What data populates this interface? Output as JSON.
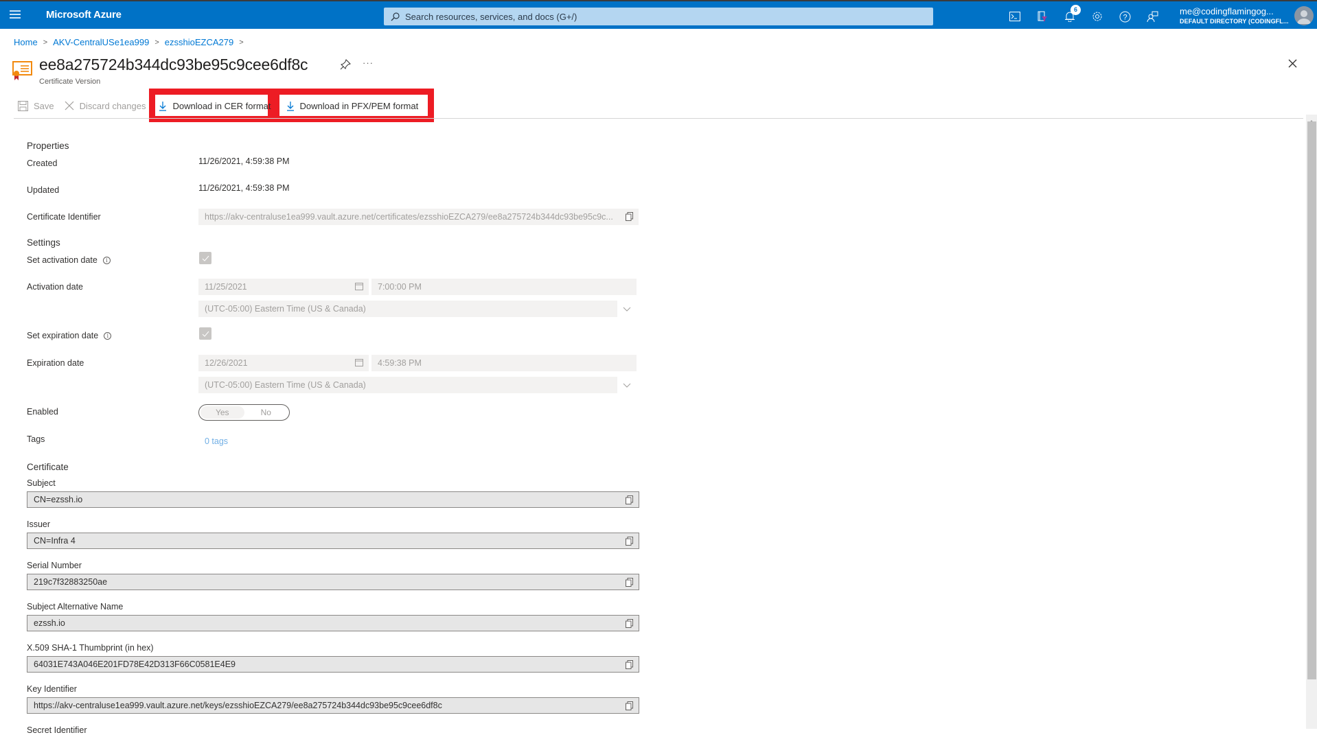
{
  "topbar": {
    "brand": "Microsoft Azure",
    "search_placeholder": "Search resources, services, and docs (G+/)",
    "notification_count": "6",
    "icons": [
      "cloud-shell-icon",
      "directory-filter-icon",
      "notifications-icon",
      "settings-icon",
      "help-icon",
      "feedback-icon"
    ],
    "account_email": "me@codingflamingog...",
    "account_directory": "DEFAULT DIRECTORY (CODINGFL..."
  },
  "breadcrumb": [
    "Home",
    "AKV-CentralUSe1ea999",
    "ezsshioEZCA279"
  ],
  "header": {
    "title": "ee8a275724b344dc93be95c9cee6df8c",
    "subtitle": "Certificate Version",
    "more_label": "···"
  },
  "toolbar": {
    "save": "Save",
    "discard": "Discard changes",
    "download_cer": "Download in CER format",
    "download_pfx": "Download in PFX/PEM format",
    "highlight_color": "#ed1c24"
  },
  "properties": {
    "section": "Properties",
    "created_label": "Created",
    "created_value": "11/26/2021, 4:59:38 PM",
    "updated_label": "Updated",
    "updated_value": "11/26/2021, 4:59:38 PM",
    "identifier_label": "Certificate Identifier",
    "identifier_value": "https://akv-centraluse1ea999.vault.azure.net/certificates/ezsshioEZCA279/ee8a275724b344dc93be95c9c..."
  },
  "settings": {
    "section": "Settings",
    "set_activation_label": "Set activation date",
    "set_activation_checked": true,
    "activation_label": "Activation date",
    "activation_date": "11/25/2021",
    "activation_time": "7:00:00 PM",
    "activation_tz": "(UTC-05:00) Eastern Time (US & Canada)",
    "set_expiration_label": "Set expiration date",
    "set_expiration_checked": true,
    "expiration_label": "Expiration date",
    "expiration_date": "12/26/2021",
    "expiration_time": "4:59:38 PM",
    "expiration_tz": "(UTC-05:00) Eastern Time (US & Canada)",
    "enabled_label": "Enabled",
    "enabled_yes": "Yes",
    "enabled_no": "No",
    "enabled_selected": "Yes",
    "tags_label": "Tags",
    "tags_value": "0 tags"
  },
  "certificate": {
    "section": "Certificate",
    "fields": [
      {
        "label": "Subject",
        "value": "CN=ezssh.io"
      },
      {
        "label": "Issuer",
        "value": "CN=Infra 4"
      },
      {
        "label": "Serial Number",
        "value": "219c7f32883250ae"
      },
      {
        "label": "Subject Alternative Name",
        "value": "ezssh.io"
      },
      {
        "label": "X.509 SHA-1 Thumbprint (in hex)",
        "value": "64031E743A046E201FD78E42D313F66C0581E4E9"
      },
      {
        "label": "Key Identifier",
        "value": "https://akv-centraluse1ea999.vault.azure.net/keys/ezsshioEZCA279/ee8a275724b344dc93be95c9cee6df8c"
      },
      {
        "label": "Secret Identifier",
        "value": ""
      }
    ]
  }
}
